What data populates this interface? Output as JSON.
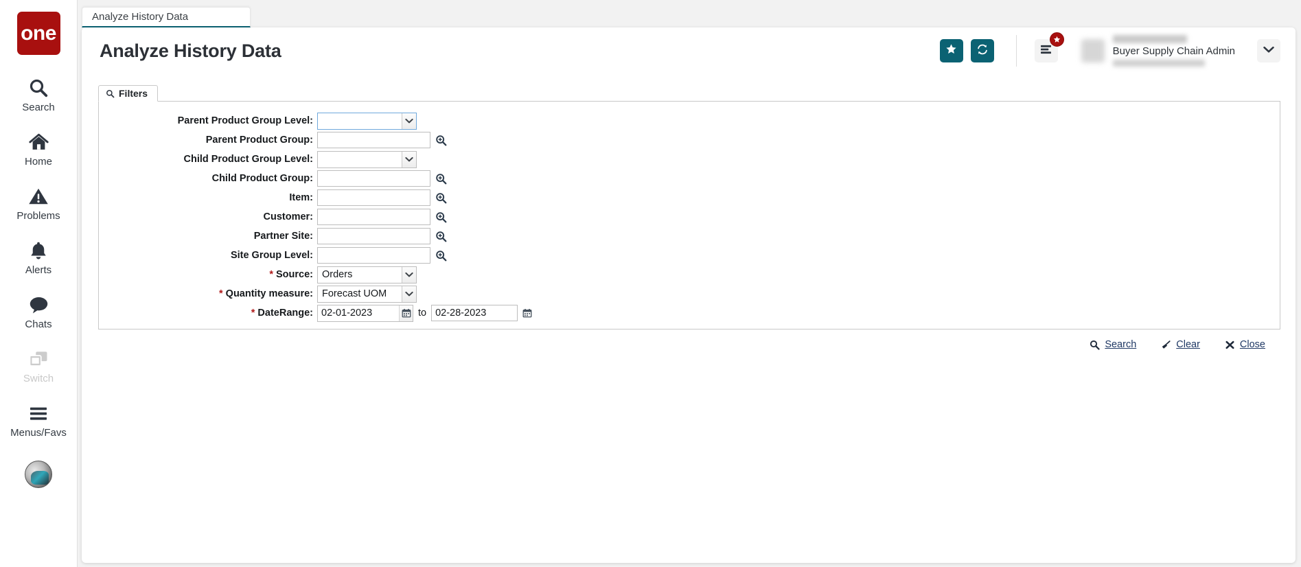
{
  "brand": {
    "logo_text": "one",
    "logo_color": "#a8100f"
  },
  "sidebar": {
    "items": [
      {
        "label": "Search",
        "icon": "search-icon",
        "disabled": false
      },
      {
        "label": "Home",
        "icon": "home-icon",
        "disabled": false
      },
      {
        "label": "Problems",
        "icon": "warning-icon",
        "disabled": false
      },
      {
        "label": "Alerts",
        "icon": "bell-icon",
        "disabled": false
      },
      {
        "label": "Chats",
        "icon": "chat-icon",
        "disabled": false
      },
      {
        "label": "Switch",
        "icon": "switch-icon",
        "disabled": true
      },
      {
        "label": "Menus/Favs",
        "icon": "hamburger-icon",
        "disabled": false
      }
    ],
    "avatar": "user-avatar-image"
  },
  "tab": {
    "label": "Analyze History Data",
    "accent": "#0b6273"
  },
  "header": {
    "title": "Analyze History Data",
    "favorite_icon": "star-icon",
    "refresh_icon": "refresh-icon",
    "menu_icon": "list-menu-icon",
    "menu_badge_icon": "star-badge-icon",
    "user_role": "Buyer Supply Chain Admin",
    "caret_icon": "chevron-down-icon",
    "button_color": "#0b6273"
  },
  "filters": {
    "tab_label": "Filters",
    "tab_icon": "search-icon",
    "rows": [
      {
        "label": "Parent Product Group Level:",
        "type": "combo",
        "value": "",
        "required": false,
        "focused": true,
        "lookup": false
      },
      {
        "label": "Parent Product Group:",
        "type": "text",
        "value": "",
        "required": false,
        "focused": false,
        "lookup": true
      },
      {
        "label": "Child Product Group Level:",
        "type": "combo",
        "value": "",
        "required": false,
        "focused": false,
        "lookup": false
      },
      {
        "label": "Child Product Group:",
        "type": "text",
        "value": "",
        "required": false,
        "focused": false,
        "lookup": true
      },
      {
        "label": "Item:",
        "type": "text",
        "value": "",
        "required": false,
        "focused": false,
        "lookup": true
      },
      {
        "label": "Customer:",
        "type": "text",
        "value": "",
        "required": false,
        "focused": false,
        "lookup": true
      },
      {
        "label": "Partner Site:",
        "type": "text",
        "value": "",
        "required": false,
        "focused": false,
        "lookup": true
      },
      {
        "label": "Site Group Level:",
        "type": "text",
        "value": "",
        "required": false,
        "focused": false,
        "lookup": true
      },
      {
        "label": "Source:",
        "type": "combo",
        "value": "Orders",
        "required": true,
        "focused": false,
        "lookup": false
      },
      {
        "label": "Quantity measure:",
        "type": "combo",
        "value": "Forecast UOM",
        "required": true,
        "focused": false,
        "lookup": false
      }
    ],
    "date_row": {
      "label": "DateRange:",
      "required": true,
      "from_value": "02-01-2023",
      "to_word": "to",
      "to_value": "02-28-2023",
      "calendar_icon": "calendar-icon"
    },
    "lookup_icon": "magnifier-plus-icon",
    "dropdown_icon": "chevron-down-icon",
    "required_marker": "*"
  },
  "actions": [
    {
      "label": "Search",
      "icon": "search-icon"
    },
    {
      "label": "Clear",
      "icon": "broom-icon"
    },
    {
      "label": "Close",
      "icon": "close-x-icon"
    }
  ]
}
